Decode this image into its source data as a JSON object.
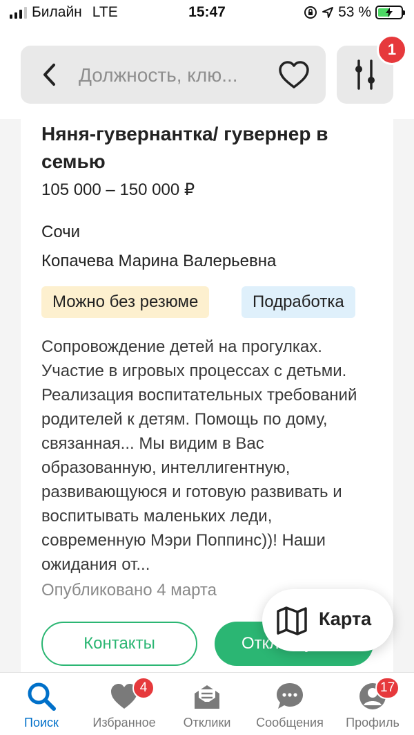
{
  "status_bar": {
    "carrier": "Билайн",
    "network": "LTE",
    "time": "15:47",
    "battery": "53 %",
    "battery_level": 0.53
  },
  "header": {
    "search_placeholder": "Должность, клю...",
    "filter_badge": "1"
  },
  "vacancy": {
    "title": "Няня-гувернантка/ гувернер в семью",
    "salary": "105 000 – 150 000 ₽",
    "city": "Сочи",
    "employer": "Копачева Марина Валерьевна",
    "tags": [
      {
        "label": "Можно без резюме",
        "color": "#fdf0cf"
      },
      {
        "label": "Подработка",
        "color": "#dff0fb"
      }
    ],
    "description": "Сопровождение детей на прогулках. Участие в игровых процессах с детьми. Реализация воспитательных требований родителей к детям. Помощь по дому, связанная... Мы видим в Вас образованную, интеллигентную, развивающуюся и готовую развивать и воспитывать маленьких леди, современную Мэри Поппинс))! Наши ожидания от...",
    "published": "Опубликовано 4 марта",
    "contacts_label": "Контакты",
    "respond_label": "Откликнуться"
  },
  "map_button": {
    "label": "Карта"
  },
  "tabbar": {
    "tabs": [
      {
        "label": "Поиск",
        "icon": "search-icon",
        "active": true
      },
      {
        "label": "Избранное",
        "icon": "heart-icon",
        "badge": "4"
      },
      {
        "label": "Отклики",
        "icon": "envelope-icon"
      },
      {
        "label": "Сообщения",
        "icon": "chat-icon"
      },
      {
        "label": "Профиль",
        "icon": "profile-icon",
        "badge": "17"
      }
    ]
  },
  "colors": {
    "accent_green": "#2bb673",
    "active_blue": "#0070c9",
    "badge_red": "#e6393c"
  }
}
